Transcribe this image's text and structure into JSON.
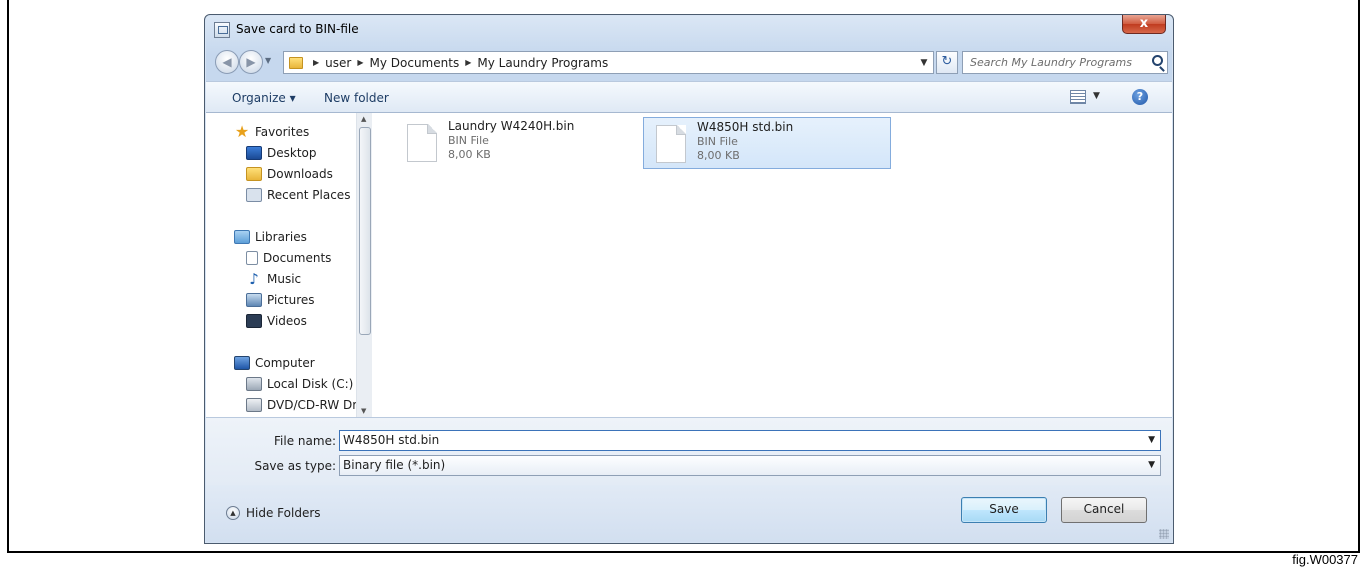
{
  "dialog": {
    "title": "Save card to BIN-file",
    "close_label": "x"
  },
  "address": {
    "breadcrumbs": [
      "user",
      "My Documents",
      "My Laundry Programs"
    ],
    "search_placeholder": "Search My Laundry Programs"
  },
  "toolbar": {
    "organize_label": "Organize ▾",
    "new_folder_label": "New folder"
  },
  "sidebar": {
    "items": [
      {
        "label": "Favorites",
        "icon": "star-icon"
      },
      {
        "label": "Desktop",
        "icon": "desktop-icon"
      },
      {
        "label": "Downloads",
        "icon": "downloads-icon"
      },
      {
        "label": "Recent Places",
        "icon": "recent-places-icon"
      },
      {
        "label": "Libraries",
        "icon": "libraries-icon"
      },
      {
        "label": "Documents",
        "icon": "documents-icon"
      },
      {
        "label": "Music",
        "icon": "music-icon"
      },
      {
        "label": "Pictures",
        "icon": "pictures-icon"
      },
      {
        "label": "Videos",
        "icon": "videos-icon"
      },
      {
        "label": "Computer",
        "icon": "computer-icon"
      },
      {
        "label": "Local Disk (C:)",
        "icon": "local-disk-icon"
      },
      {
        "label": "DVD/CD-RW Driv",
        "icon": "dvd-drive-icon"
      }
    ]
  },
  "files": [
    {
      "name": "Laundry W4240H.bin",
      "type": "BIN File",
      "size": "8,00 KB",
      "selected": false
    },
    {
      "name": "W4850H std.bin",
      "type": "BIN File",
      "size": "8,00 KB",
      "selected": true
    }
  ],
  "fields": {
    "file_name_label": "File name:",
    "file_name_value": "W4850H std.bin",
    "save_type_label": "Save as type:",
    "save_type_value": "Binary file (*.bin)"
  },
  "footer": {
    "hide_folders_label": "Hide Folders",
    "save_label": "Save",
    "cancel_label": "Cancel"
  },
  "figure": {
    "caption": "fig.W00377"
  }
}
